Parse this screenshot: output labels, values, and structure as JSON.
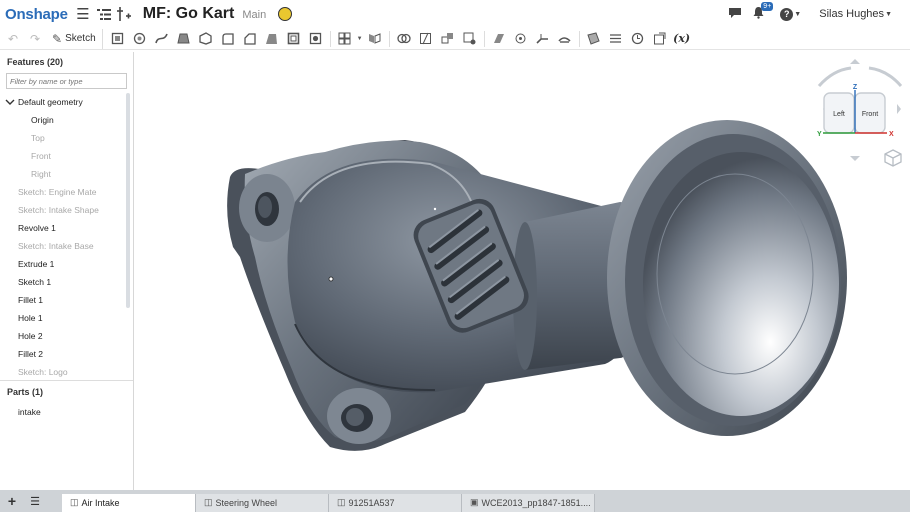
{
  "topbar": {
    "logo": "Onshape",
    "doc_title": "MF: Go Kart",
    "workspace": "Main",
    "notification_count": "9+",
    "user_name": "Silas Hughes",
    "icons": [
      "hamburger-icon",
      "feature-list-icon",
      "variables-icon",
      "globe-icon",
      "chat-icon",
      "bell-icon",
      "help-icon"
    ]
  },
  "toolbar": {
    "sketch_label": "Sketch",
    "formula_label": "(x)"
  },
  "panel": {
    "features_header": "Features (20)",
    "filter_placeholder": "Filter by name or type",
    "default_geometry": "Default geometry",
    "features": [
      {
        "label": "Origin",
        "level": "sub",
        "state": "active"
      },
      {
        "label": "Top",
        "level": "sub",
        "state": "suppressed"
      },
      {
        "label": "Front",
        "level": "sub",
        "state": "suppressed"
      },
      {
        "label": "Right",
        "level": "sub",
        "state": "suppressed"
      },
      {
        "label": "Sketch: Engine Mate",
        "level": "top",
        "state": "suppressed"
      },
      {
        "label": "Sketch: Intake Shape",
        "level": "top",
        "state": "suppressed"
      },
      {
        "label": "Revolve 1",
        "level": "top",
        "state": "active"
      },
      {
        "label": "Sketch: Intake Base",
        "level": "top",
        "state": "suppressed"
      },
      {
        "label": "Extrude 1",
        "level": "top",
        "state": "active"
      },
      {
        "label": "Sketch 1",
        "level": "top",
        "state": "active"
      },
      {
        "label": "Fillet 1",
        "level": "top",
        "state": "active"
      },
      {
        "label": "Hole 1",
        "level": "top",
        "state": "active"
      },
      {
        "label": "Hole 2",
        "level": "top",
        "state": "active"
      },
      {
        "label": "Fillet 2",
        "level": "top",
        "state": "active"
      },
      {
        "label": "Sketch: Logo",
        "level": "top",
        "state": "suppressed"
      }
    ],
    "parts_header": "Parts (1)",
    "parts": [
      "intake"
    ]
  },
  "viewcube": {
    "left_label": "Left",
    "front_label": "Front",
    "axis_z": "Z",
    "axis_y": "Y",
    "axis_x": "X",
    "axis_colors": {
      "x": "#d0312d",
      "y": "#2e9b3b",
      "z": "#2b6cb8"
    }
  },
  "tabs": [
    {
      "label": "Air Intake",
      "icon": "part-studio-icon",
      "active": true
    },
    {
      "label": "Steering Wheel",
      "icon": "part-studio-icon",
      "active": false
    },
    {
      "label": "91251A537",
      "icon": "part-studio-icon",
      "active": false
    },
    {
      "label": "WCE2013_pp1847-1851....",
      "icon": "image-icon",
      "active": false
    }
  ],
  "colors": {
    "brand": "#2b6cb8",
    "model": "#5b6470",
    "tabbar": "#cfd3d7"
  }
}
